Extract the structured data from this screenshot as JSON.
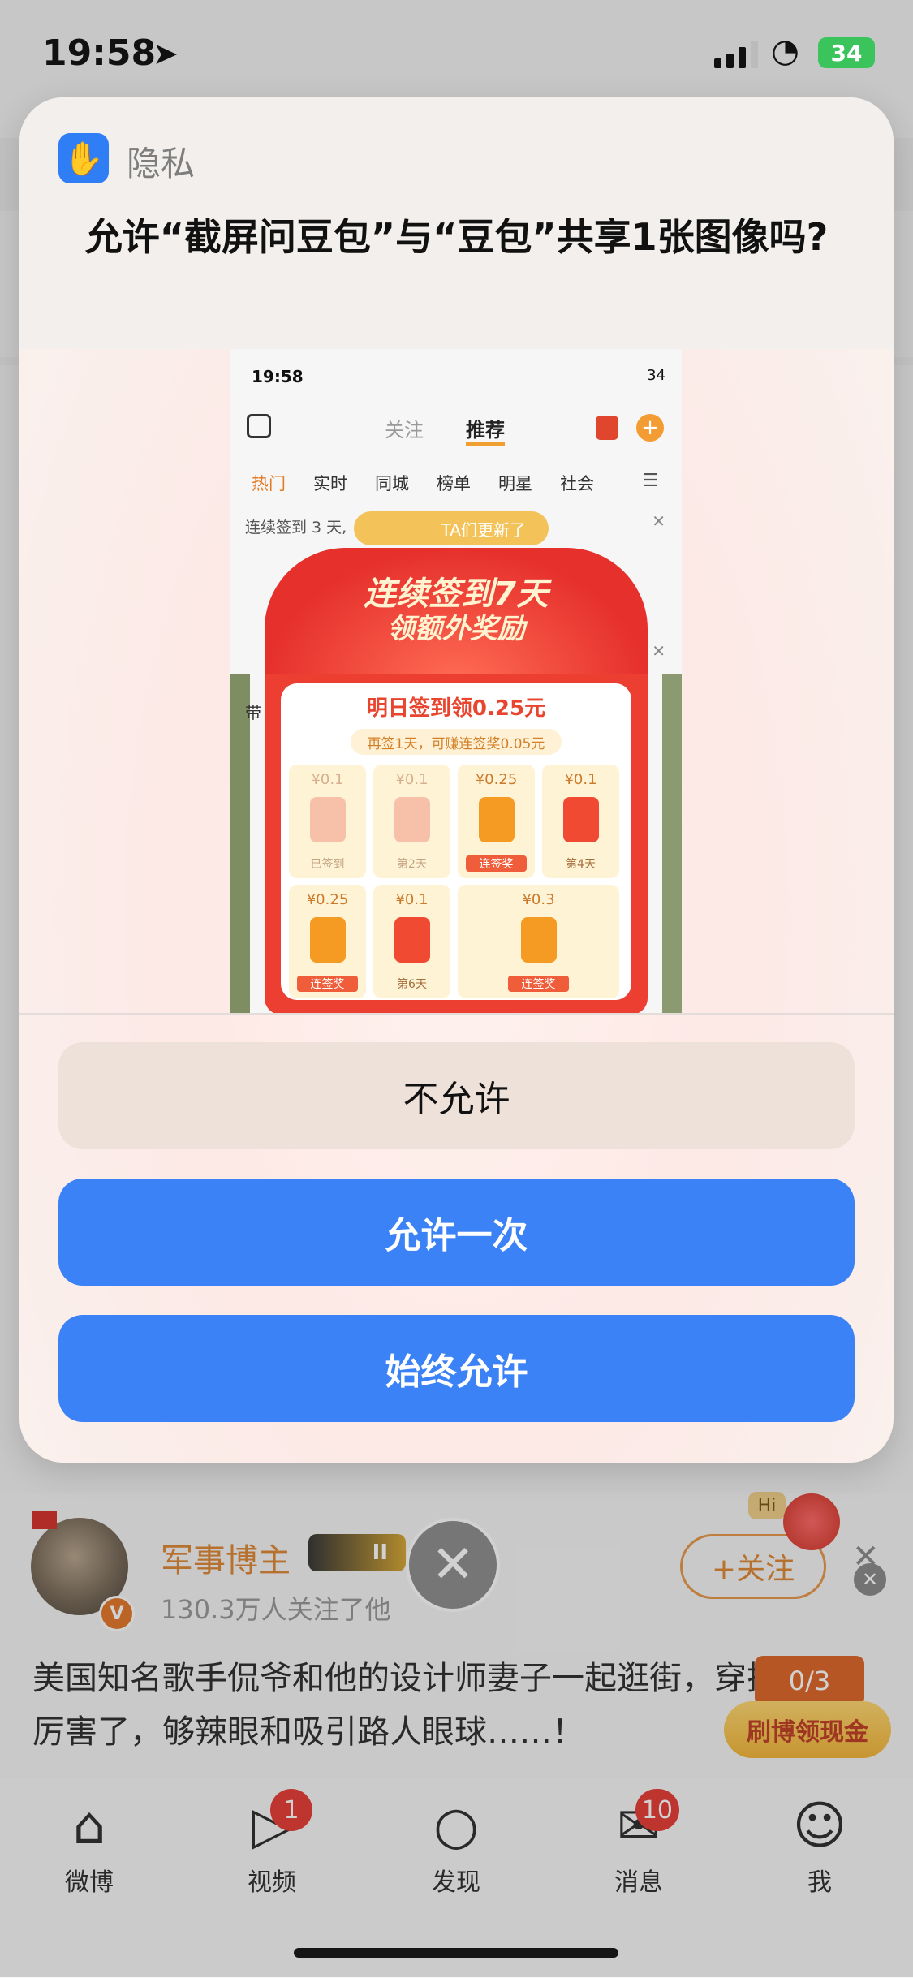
{
  "status_bar": {
    "time": "19:58",
    "battery": "34"
  },
  "background_app": {
    "post": {
      "username": "军事博主",
      "level_badge": "II",
      "followers": "130.3万人关注了他",
      "follow_label": "+关注",
      "text": "美国知名歌手侃爷和他的设计师妻子一起逛街，穿搭厉害了，够辣眼和吸引路人眼球……！",
      "counter": "0/3",
      "reward_label": "刷博领现金",
      "hi_label": "Hi"
    },
    "tabbar": [
      {
        "label": "微博",
        "icon": "home-icon",
        "badge": ""
      },
      {
        "label": "视频",
        "icon": "video-icon",
        "badge": "1"
      },
      {
        "label": "发现",
        "icon": "search-icon",
        "badge": ""
      },
      {
        "label": "消息",
        "icon": "mail-icon",
        "badge": "10"
      },
      {
        "label": "我",
        "icon": "profile-icon",
        "badge": ""
      }
    ]
  },
  "dialog": {
    "header_label": "隐私",
    "question": "允许“截屏问豆包”与“豆包”共享1张图像吗?",
    "buttons": {
      "deny": "不允许",
      "allow_once": "允许一次",
      "always_allow": "始终允许"
    }
  },
  "preview": {
    "status_time": "19:58",
    "status_battery": "34",
    "tabs": {
      "follow": "关注",
      "recommend": "推荐"
    },
    "categories": [
      "热门",
      "实时",
      "同城",
      "榜单",
      "明星",
      "社会"
    ],
    "banner_text": "连续签到 3 天,",
    "update_pill": "TA们更新了",
    "side_label": "带",
    "popup": {
      "title_line1": "连续签到7天",
      "title_line2": "领额外奖励",
      "card_title": "明日签到领0.25元",
      "card_subtitle": "再签1天，可赚连签奖0.05元",
      "cells": [
        {
          "amount": "¥0.1",
          "label": "已签到"
        },
        {
          "amount": "¥0.1",
          "label": "第2天"
        },
        {
          "amount": "¥0.25",
          "label": "连签奖"
        },
        {
          "amount": "¥0.1",
          "label": "第4天"
        },
        {
          "amount": "¥0.25",
          "label": "连签奖"
        },
        {
          "amount": "¥0.1",
          "label": "第6天"
        },
        {
          "amount": "¥0.3",
          "label": "连签奖"
        }
      ]
    }
  },
  "colors": {
    "accent_blue": "#3b82f6",
    "deny_bg": "#eee1da",
    "weibo_orange": "#e08a3a"
  }
}
